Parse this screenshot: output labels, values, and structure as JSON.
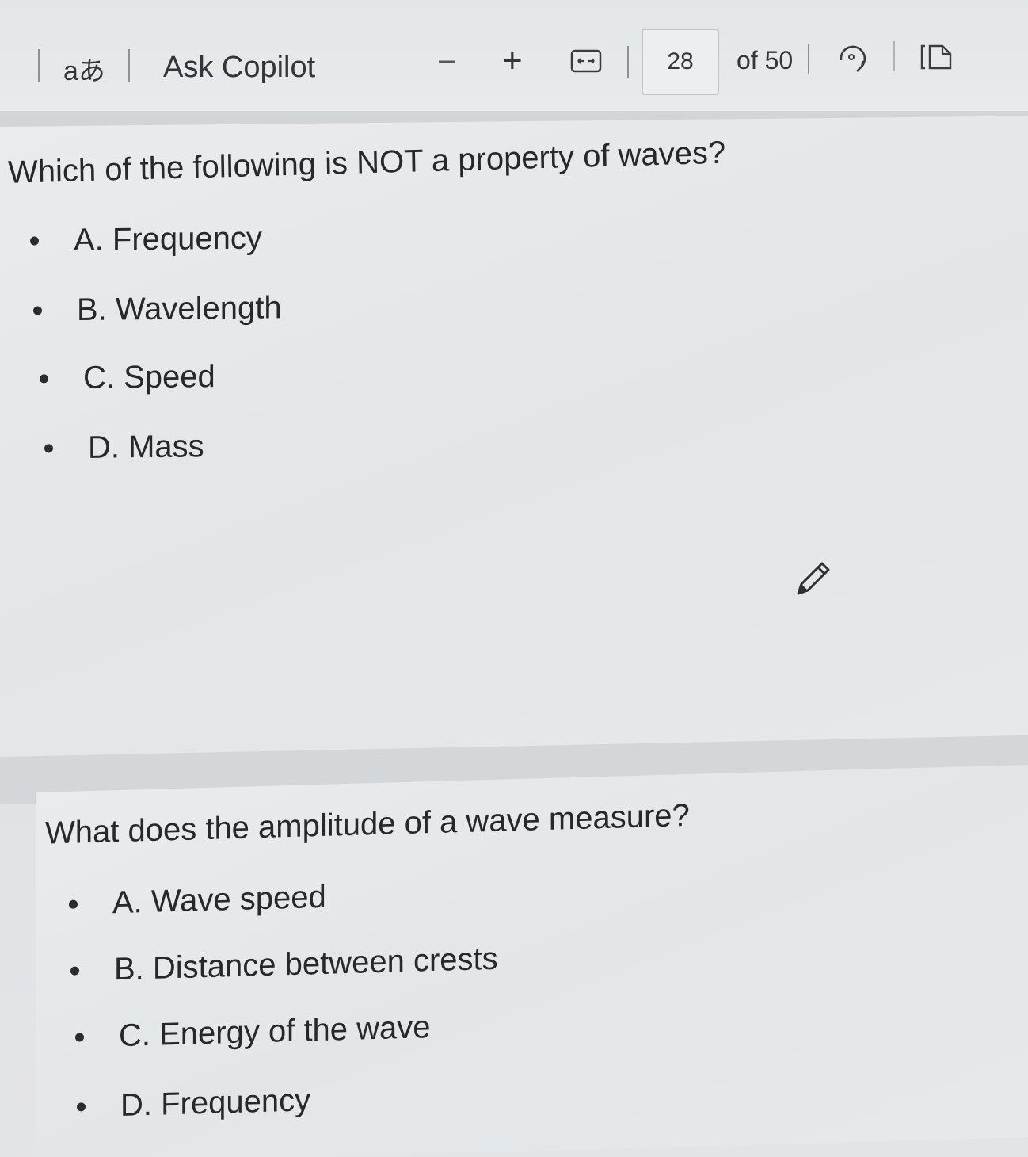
{
  "toolbar": {
    "translate_label": "aあ",
    "ask_copilot_label": "Ask Copilot",
    "zoom_out_label": "−",
    "zoom_in_label": "+",
    "current_page": "28",
    "page_total_label": "of 50"
  },
  "questions": [
    {
      "text": "Which of the following is NOT a property of waves?",
      "options": [
        "A. Frequency",
        "B. Wavelength",
        "C. Speed",
        "D. Mass"
      ]
    },
    {
      "text": "What does the amplitude of a wave measure?",
      "options": [
        "A. Wave speed",
        "B. Distance between crests",
        "C. Energy of the wave",
        "D. Frequency"
      ]
    }
  ],
  "icons": {
    "fit_width": "fit-width-icon",
    "rotate": "rotate-icon",
    "page_view": "page-view-icon",
    "pencil": "pencil-icon"
  }
}
